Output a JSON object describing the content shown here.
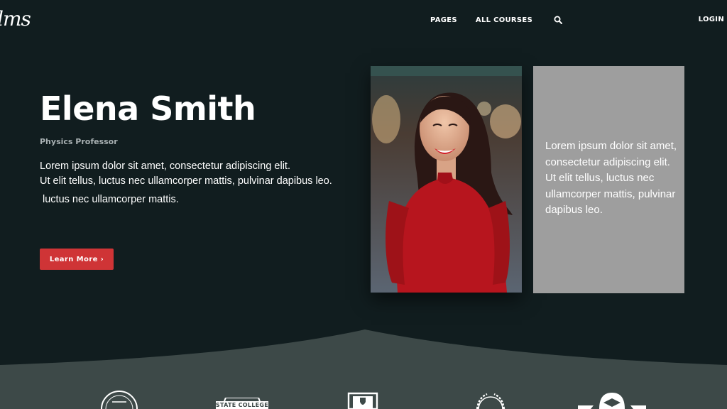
{
  "brand": {
    "logo_text": "lms"
  },
  "nav": {
    "items": [
      {
        "label": "PAGES"
      },
      {
        "label": "ALL COURSES"
      }
    ],
    "search_icon": "search-icon",
    "login_label": "LOGIN"
  },
  "hero": {
    "name": "Elena Smith",
    "role": "Physics Professor",
    "description_line1": "Lorem ipsum dolor sit amet, consectetur adipiscing elit.",
    "description_line2": "Ut elit tellus, luctus nec ullamcorper mattis, pulvinar dapibus leo.",
    "description_extra": "luctus nec ullamcorper mattis.",
    "cta_label": "Learn More ›"
  },
  "quote_card": {
    "text": "Lorem ipsum dolor sit amet, consectetur adipiscing elit. Ut elit tellus, luctus nec ullamcorper mattis, pulvinar dapibus leo."
  },
  "partners": [
    {
      "name": "university-seal-logo"
    },
    {
      "label": "STATE COLLEGE"
    },
    {
      "name": "shield-crest-logo"
    },
    {
      "name": "laurel-badge-logo"
    },
    {
      "name": "graduation-cap-badge-logo"
    }
  ],
  "colors": {
    "background": "#111d1f",
    "band": "#3d4948",
    "accent": "#cf3436",
    "card": "#9e9e9e",
    "muted_text": "#a8b0b2"
  }
}
